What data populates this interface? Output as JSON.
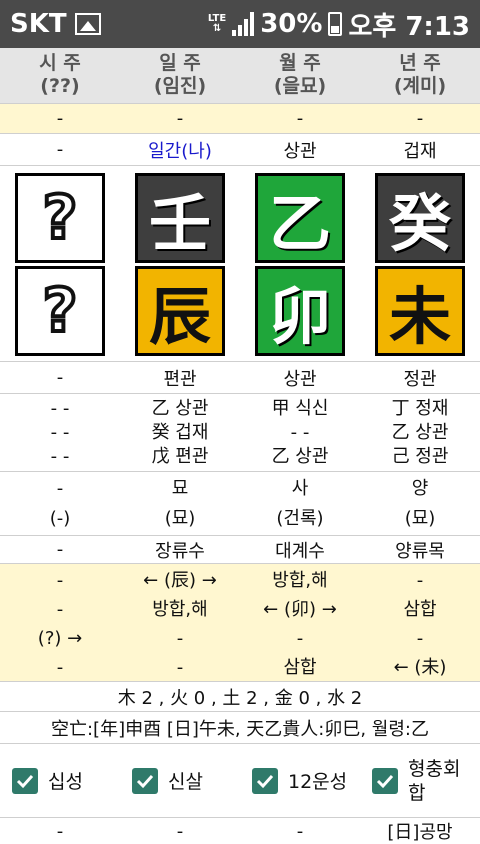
{
  "status": {
    "carrier": "SKT",
    "battery_pct": "30%",
    "clock": "오후 7:13",
    "lte": "LTE"
  },
  "header": [
    {
      "title": "시 주",
      "sub": "(??)"
    },
    {
      "title": "일 주",
      "sub": "(임진)"
    },
    {
      "title": "월 주",
      "sub": "(을묘)"
    },
    {
      "title": "년 주",
      "sub": "(계미)"
    }
  ],
  "row1": [
    "-",
    "-",
    "-",
    "-"
  ],
  "row2": [
    "-",
    "일간(나)",
    "상관",
    "겁재"
  ],
  "stems": [
    "?",
    "壬",
    "乙",
    "癸"
  ],
  "branches": [
    "?",
    "辰",
    "卯",
    "未"
  ],
  "row3": [
    "-",
    "편관",
    "상관",
    "정관"
  ],
  "hidden": [
    [
      "- -",
      "- -",
      "- -"
    ],
    [
      "乙 상관",
      "癸 겁재",
      "戊 편관"
    ],
    [
      "甲 식신",
      "- -",
      "乙 상관"
    ],
    [
      "丁 정재",
      "乙 상관",
      "己 정관"
    ]
  ],
  "row5a": [
    "-",
    "묘",
    "사",
    "양"
  ],
  "row5b": [
    "(-)",
    "(묘)",
    "(건록)",
    "(묘)"
  ],
  "row6": [
    "-",
    "장류수",
    "대계수",
    "양류목"
  ],
  "relations": [
    [
      "-",
      "-",
      "(?) →",
      "-"
    ],
    [
      "← (辰) →",
      "방합,해",
      "-",
      "-"
    ],
    [
      "방합,해",
      "← (卯) →",
      "-",
      "삼합"
    ],
    [
      "-",
      "삼합",
      "-",
      "← (未)"
    ]
  ],
  "elements": "木 2 , 火 0 , 土 2 , 金 0 , 水 2",
  "extra": "空亡:[年]申酉 [日]午未, 天乙貴人:卯巳, 월령:乙",
  "checks": [
    {
      "label": "십성",
      "checked": true
    },
    {
      "label": "신살",
      "checked": true
    },
    {
      "label": "12운성",
      "checked": true
    },
    {
      "label": "형충회합",
      "checked": true
    }
  ],
  "row11": [
    "-",
    "-",
    "-",
    "[日]공망"
  ]
}
